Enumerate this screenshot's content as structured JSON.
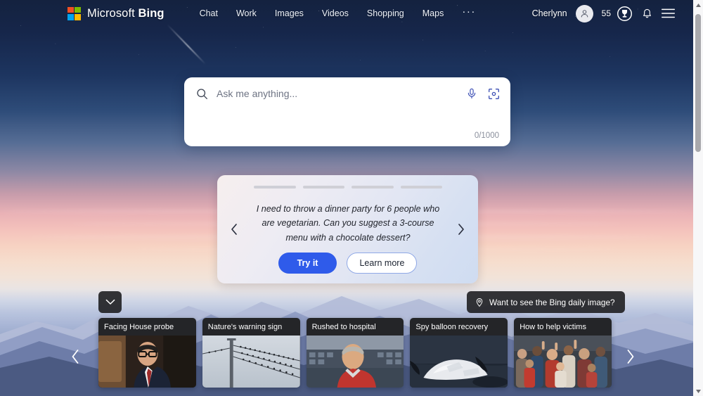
{
  "header": {
    "brand_prefix": "Microsoft ",
    "brand_suffix": "Bing",
    "logo_name": "microsoft-logo",
    "logo_colors": [
      "#f25022",
      "#7fba00",
      "#00a4ef",
      "#ffb900"
    ],
    "nav": [
      {
        "label": "Chat"
      },
      {
        "label": "Work"
      },
      {
        "label": "Images"
      },
      {
        "label": "Videos"
      },
      {
        "label": "Shopping"
      },
      {
        "label": "Maps"
      }
    ],
    "more_label": "···",
    "user_name": "Cherlynn",
    "rewards_points": "55"
  },
  "search": {
    "placeholder": "Ask me anything...",
    "value": "",
    "counter": "0/1000"
  },
  "suggestion": {
    "progress_total": 4,
    "progress_active_index": 0,
    "progress_active_pct": 80,
    "active_color": "#2b3f9e",
    "prompt": "I need to throw a dinner party for 6 people who are vegetarian. Can you suggest a 3-course menu with a chocolate dessert?",
    "try_label": "Try it",
    "learn_label": "Learn more",
    "accent_color": "#2f5bea"
  },
  "daily_image": {
    "label": "Want to see the Bing daily image?"
  },
  "news": {
    "cards": [
      {
        "title": "Facing House probe"
      },
      {
        "title": "Nature's warning sign"
      },
      {
        "title": "Rushed to hospital"
      },
      {
        "title": "Spy balloon recovery"
      },
      {
        "title": "How to help victims"
      }
    ]
  }
}
